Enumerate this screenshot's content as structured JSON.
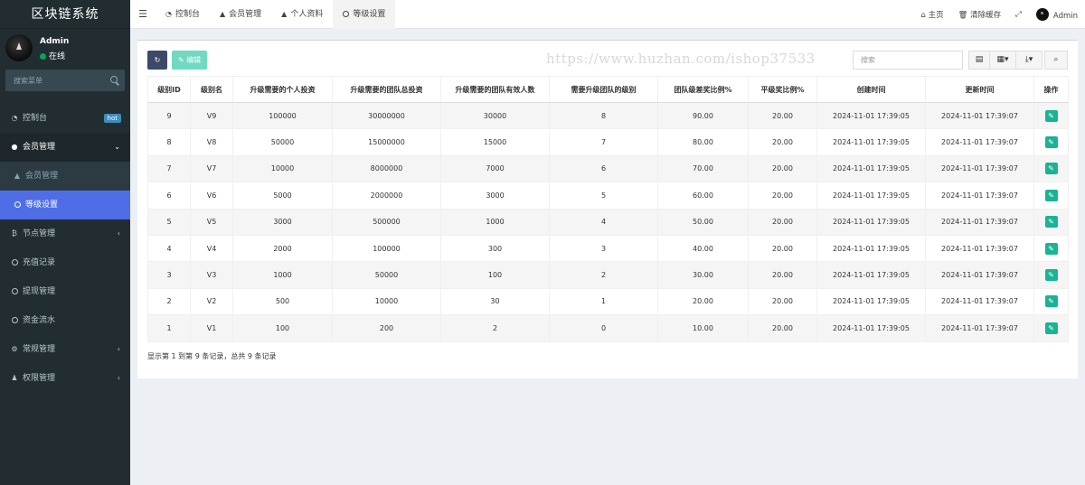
{
  "app_title": "区块链系统",
  "user": {
    "name": "Admin",
    "status": "在线"
  },
  "sidebar": {
    "search_placeholder": "搜索菜单",
    "items": [
      {
        "label": "控制台",
        "badge": "hot"
      },
      {
        "label": "会员管理"
      },
      {
        "label": "会员管理"
      },
      {
        "label": "等级设置"
      },
      {
        "label": "节点管理"
      },
      {
        "label": "充值记录"
      },
      {
        "label": "提现管理"
      },
      {
        "label": "资金流水"
      },
      {
        "label": "常规管理"
      },
      {
        "label": "权限管理"
      }
    ]
  },
  "tabs": [
    {
      "label": "控制台"
    },
    {
      "label": "会员管理"
    },
    {
      "label": "个人资料"
    },
    {
      "label": "等级设置"
    }
  ],
  "topbar": {
    "home": "主页",
    "clear_cache": "清除缓存",
    "admin": "Admin"
  },
  "watermark": "https://www.huzhan.com/ishop37533",
  "toolbar": {
    "edit_label": "编辑",
    "search_placeholder": "搜索"
  },
  "table": {
    "headers": [
      "级别ID",
      "级别名",
      "升级需要的个人投资",
      "升级需要的团队总投资",
      "升级需要的团队有效人数",
      "需要升级团队的级别",
      "团队级差奖比例%",
      "平级奖比例%",
      "创建时间",
      "更新时间",
      "操作"
    ],
    "rows": [
      [
        "9",
        "V9",
        "100000",
        "30000000",
        "30000",
        "8",
        "90.00",
        "20.00",
        "2024-11-01 17:39:05",
        "2024-11-01 17:39:07"
      ],
      [
        "8",
        "V8",
        "50000",
        "15000000",
        "15000",
        "7",
        "80.00",
        "20.00",
        "2024-11-01 17:39:05",
        "2024-11-01 17:39:07"
      ],
      [
        "7",
        "V7",
        "10000",
        "8000000",
        "7000",
        "6",
        "70.00",
        "20.00",
        "2024-11-01 17:39:05",
        "2024-11-01 17:39:07"
      ],
      [
        "6",
        "V6",
        "5000",
        "2000000",
        "3000",
        "5",
        "60.00",
        "20.00",
        "2024-11-01 17:39:05",
        "2024-11-01 17:39:07"
      ],
      [
        "5",
        "V5",
        "3000",
        "500000",
        "1000",
        "4",
        "50.00",
        "20.00",
        "2024-11-01 17:39:05",
        "2024-11-01 17:39:07"
      ],
      [
        "4",
        "V4",
        "2000",
        "100000",
        "300",
        "3",
        "40.00",
        "20.00",
        "2024-11-01 17:39:05",
        "2024-11-01 17:39:07"
      ],
      [
        "3",
        "V3",
        "1000",
        "50000",
        "100",
        "2",
        "30.00",
        "20.00",
        "2024-11-01 17:39:05",
        "2024-11-01 17:39:07"
      ],
      [
        "2",
        "V2",
        "500",
        "10000",
        "30",
        "1",
        "20.00",
        "20.00",
        "2024-11-01 17:39:05",
        "2024-11-01 17:39:07"
      ],
      [
        "1",
        "V1",
        "100",
        "200",
        "2",
        "0",
        "10.00",
        "20.00",
        "2024-11-01 17:39:05",
        "2024-11-01 17:39:07"
      ]
    ]
  },
  "footer_text": "显示第 1 到第 9 条记录，总共 9 条记录",
  "colors": {
    "sidebar_bg": "#222d32",
    "active_item": "#4f6de6",
    "edit_button": "#1ab394",
    "refresh_button": "#3c4a6a",
    "online": "#00a65a"
  }
}
